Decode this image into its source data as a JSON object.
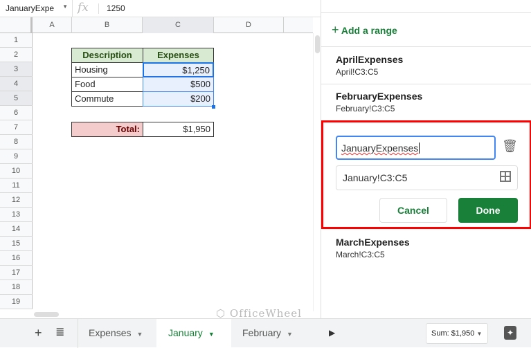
{
  "formula_bar": {
    "name_box": "JanuaryExpe",
    "fx": "fx",
    "value": "1250"
  },
  "columns": [
    "A",
    "B",
    "C",
    "D"
  ],
  "rows": [
    "1",
    "2",
    "3",
    "4",
    "5",
    "6",
    "7",
    "8",
    "9",
    "10",
    "11",
    "12",
    "13",
    "14",
    "15",
    "16",
    "17",
    "18",
    "19"
  ],
  "table": {
    "headers": [
      "Description",
      "Expenses"
    ],
    "rows": [
      {
        "desc": "Housing",
        "amt": "$1,250"
      },
      {
        "desc": "Food",
        "amt": "$500"
      },
      {
        "desc": "Commute",
        "amt": "$200"
      }
    ],
    "total_label": "Total:",
    "total_value": "$1,950"
  },
  "sheet_tabs": {
    "add": "+",
    "list": "≣",
    "tabs": [
      "Expenses",
      "January",
      "February"
    ],
    "active": "January",
    "sum": "Sum: $1,950"
  },
  "watermark": "OfficeWheel",
  "panel": {
    "add_range": "Add a range",
    "ranges": [
      {
        "name": "AprilExpenses",
        "ref": "April!C3:C5"
      },
      {
        "name": "FebruaryExpenses",
        "ref": "February!C3:C5"
      },
      {
        "name": "MarchExpenses",
        "ref": "March!C3:C5"
      }
    ],
    "edit": {
      "name_value": "JanuaryExpenses",
      "range_value": "January!C3:C5",
      "cancel": "Cancel",
      "done": "Done"
    }
  },
  "colors": {
    "accent_green": "#188038",
    "header_fill": "#d9ead3",
    "total_fill": "#f4cccc",
    "highlight": "#ff0000"
  }
}
